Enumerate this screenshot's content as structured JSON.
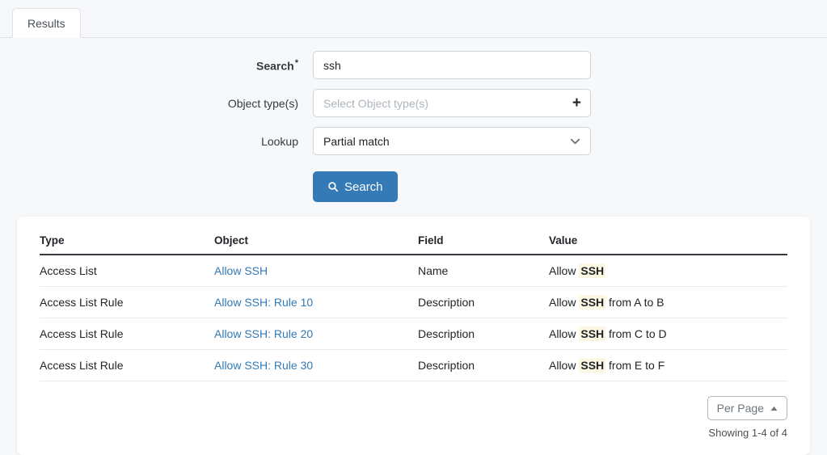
{
  "tabs": [
    {
      "label": "Results",
      "active": true
    }
  ],
  "form": {
    "search": {
      "label": "Search",
      "required_marker": "*",
      "value": "ssh"
    },
    "object_types": {
      "label": "Object type(s)",
      "value": "",
      "placeholder": "Select Object type(s)",
      "addon_icon": "plus-icon"
    },
    "lookup": {
      "label": "Lookup",
      "value": "Partial match",
      "options": [
        "Partial match"
      ],
      "addon_icon": "chevron-down-icon"
    },
    "submit": {
      "label": "Search",
      "icon": "search-icon",
      "color": "#337ab7"
    }
  },
  "results": {
    "columns": [
      "Type",
      "Object",
      "Field",
      "Value"
    ],
    "highlight_color": "#fcf7e3",
    "link_color": "#337ab7",
    "rows": [
      {
        "type": "Access List",
        "object": "Allow SSH",
        "field": "Name",
        "value_prefix": "Allow ",
        "value_highlight": "SSH",
        "value_suffix": ""
      },
      {
        "type": "Access List Rule",
        "object": "Allow SSH: Rule 10",
        "field": "Description",
        "value_prefix": "Allow ",
        "value_highlight": "SSH",
        "value_suffix": " from A to B"
      },
      {
        "type": "Access List Rule",
        "object": "Allow SSH: Rule 20",
        "field": "Description",
        "value_prefix": "Allow ",
        "value_highlight": "SSH",
        "value_suffix": " from C to D"
      },
      {
        "type": "Access List Rule",
        "object": "Allow SSH: Rule 30",
        "field": "Description",
        "value_prefix": "Allow ",
        "value_highlight": "SSH",
        "value_suffix": " from E to F"
      }
    ]
  },
  "pagination": {
    "per_page_label": "Per Page",
    "per_page_icon": "caret-up-icon",
    "showing": "Showing 1-4 of 4"
  }
}
